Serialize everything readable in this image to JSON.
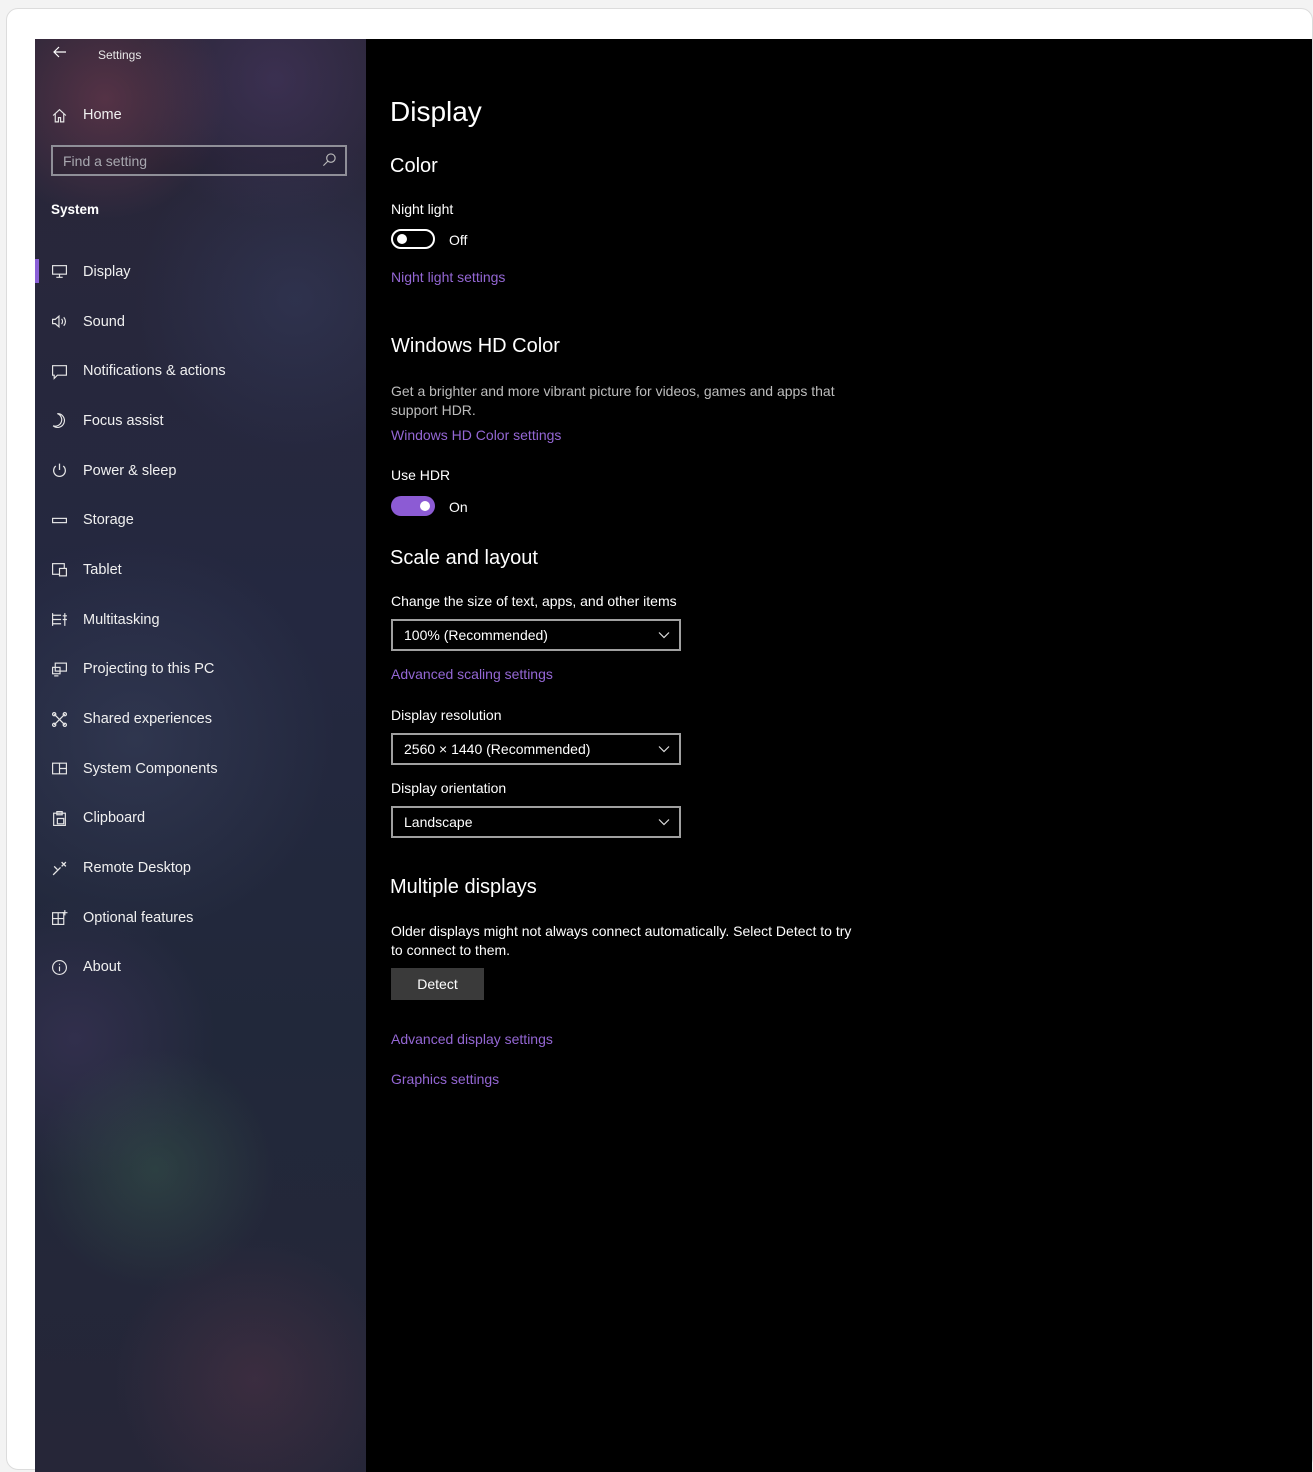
{
  "app": {
    "title": "Settings"
  },
  "sidebar": {
    "home_label": "Home",
    "search_placeholder": "Find a setting",
    "section": "System",
    "items": [
      {
        "label": "Display",
        "icon": "monitor-icon",
        "active": true
      },
      {
        "label": "Sound",
        "icon": "speaker-icon"
      },
      {
        "label": "Notifications & actions",
        "icon": "message-icon"
      },
      {
        "label": "Focus assist",
        "icon": "moon-icon"
      },
      {
        "label": "Power & sleep",
        "icon": "power-icon"
      },
      {
        "label": "Storage",
        "icon": "storage-icon"
      },
      {
        "label": "Tablet",
        "icon": "tablet-icon"
      },
      {
        "label": "Multitasking",
        "icon": "multitasking-icon"
      },
      {
        "label": "Projecting to this PC",
        "icon": "projecting-icon"
      },
      {
        "label": "Shared experiences",
        "icon": "shared-icon"
      },
      {
        "label": "System Components",
        "icon": "components-icon"
      },
      {
        "label": "Clipboard",
        "icon": "clipboard-icon"
      },
      {
        "label": "Remote Desktop",
        "icon": "remote-icon"
      },
      {
        "label": "Optional features",
        "icon": "features-icon"
      },
      {
        "label": "About",
        "icon": "info-icon"
      }
    ]
  },
  "main": {
    "title": "Display",
    "color": {
      "heading": "Color",
      "night_light_label": "Night light",
      "night_light_state": "Off",
      "night_light_link": "Night light settings"
    },
    "hd_color": {
      "heading": "Windows HD Color",
      "description": "Get a brighter and more vibrant picture for videos, games and apps that support HDR.",
      "link": "Windows HD Color settings",
      "use_hdr_label": "Use HDR",
      "use_hdr_state": "On"
    },
    "scale": {
      "heading": "Scale and layout",
      "size_label": "Change the size of text, apps, and other items",
      "size_value": "100% (Recommended)",
      "advanced_link": "Advanced scaling settings",
      "resolution_label": "Display resolution",
      "resolution_value": "2560 × 1440 (Recommended)",
      "orientation_label": "Display orientation",
      "orientation_value": "Landscape"
    },
    "multiple": {
      "heading": "Multiple displays",
      "description": "Older displays might not always connect automatically. Select Detect to try to connect to them.",
      "detect_button": "Detect",
      "advanced_link": "Advanced display settings",
      "graphics_link": "Graphics settings"
    }
  },
  "colors": {
    "accent": "#8c5bd4",
    "link": "#9467d4",
    "background": "#000000"
  }
}
